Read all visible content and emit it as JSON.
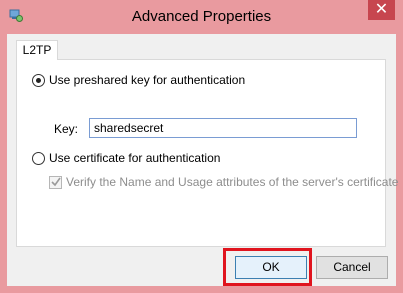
{
  "window": {
    "title": "Advanced Properties",
    "close_glyph": "✕",
    "app_icon": "network-adapter-icon"
  },
  "tabs": [
    {
      "label": "L2TP",
      "selected": true
    }
  ],
  "options": {
    "preshared_key": {
      "label": "Use preshared key for authentication",
      "selected": true
    },
    "key": {
      "label": "Key:",
      "value": "sharedsecret"
    },
    "certificate": {
      "label": "Use certificate for authentication",
      "selected": false
    },
    "verify_certificate": {
      "label": "Verify the Name and Usage attributes of the server's certificate",
      "checked": true,
      "enabled": false
    }
  },
  "buttons": {
    "ok": "OK",
    "cancel": "Cancel"
  },
  "colors": {
    "titlebar": "#e99a9f",
    "close_button": "#c7464f",
    "highlight_box": "#e0141e",
    "client_background": "#f0f0f0"
  }
}
